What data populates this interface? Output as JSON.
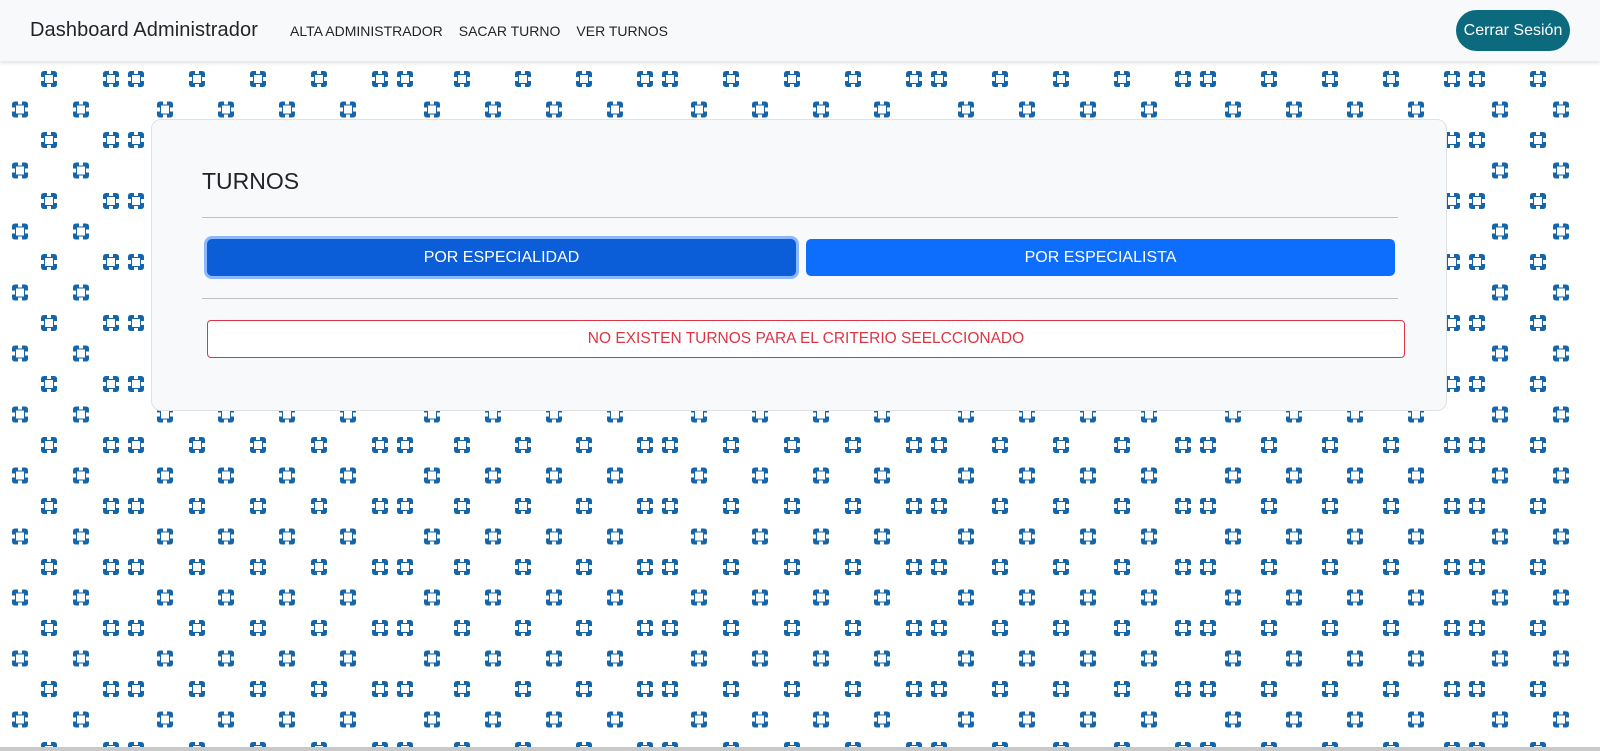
{
  "navbar": {
    "brand": "Dashboard Administrador",
    "links": [
      "ALTA ADMINISTRADOR",
      "SACAR TURNO",
      "VER TURNOS"
    ],
    "logout_label": "Cerrar Sesión"
  },
  "panel": {
    "title": "TURNOS",
    "buttons": {
      "especialidad": "POR ESPECIALIDAD",
      "especialista": "POR ESPECIALISTA"
    },
    "alert": "NO EXISTEN TURNOS PARA EL CRITERIO SEELCCIONADO"
  },
  "background": {
    "icon": "medical-cross-icon",
    "icon_color": "#1565a8"
  },
  "colors": {
    "primary": "#0d6efd",
    "primary_active": "#0b5ed7",
    "logout": "#0b6a7e",
    "danger": "#dc3545"
  }
}
